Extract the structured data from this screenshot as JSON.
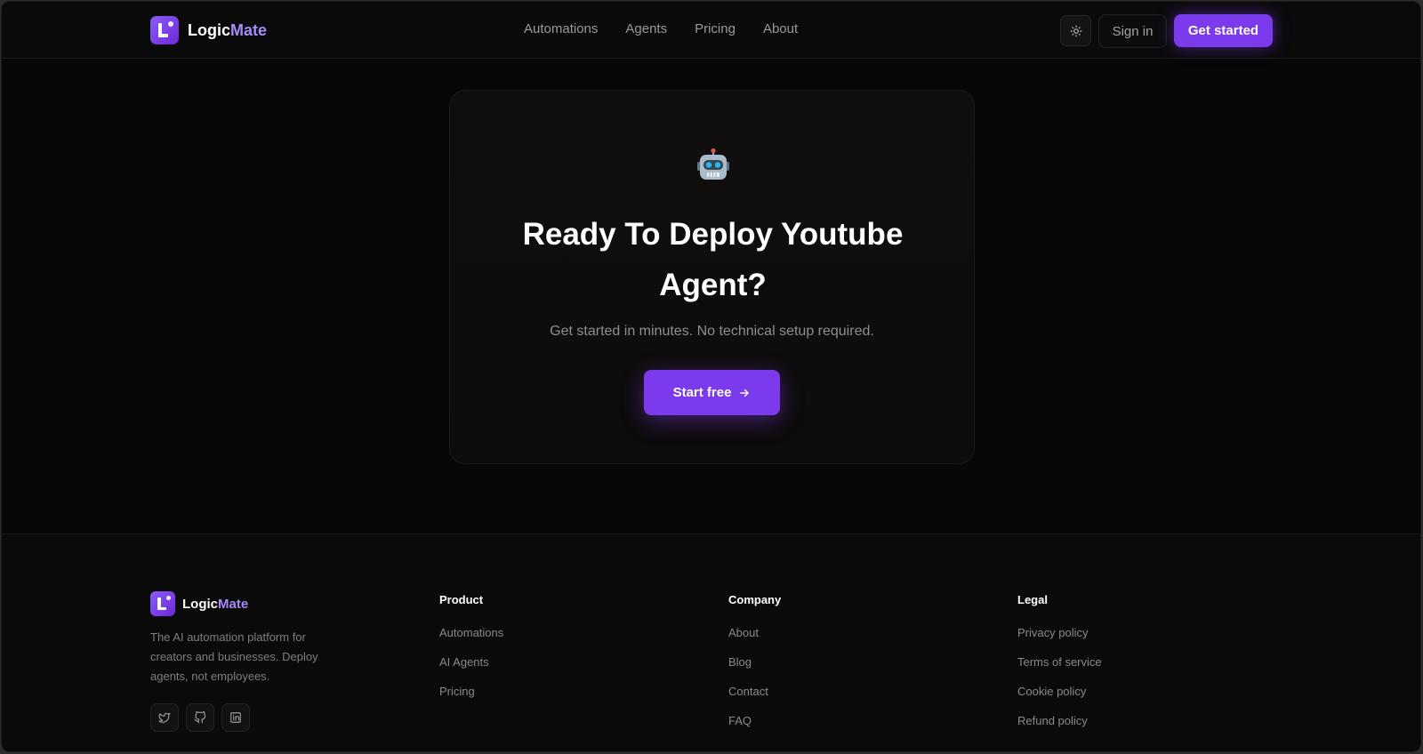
{
  "brand": {
    "name_main": "Logic",
    "name_accent": "Mate"
  },
  "nav": {
    "items": [
      {
        "label": "Automations"
      },
      {
        "label": "Agents"
      },
      {
        "label": "Pricing"
      },
      {
        "label": "About"
      }
    ],
    "signin_label": "Sign in",
    "getstarted_label": "Get started",
    "theme_icon": "sun-icon"
  },
  "cta": {
    "emoji": "robot-emoji",
    "title": "Ready To Deploy Youtube Agent?",
    "subtitle": "Get started in minutes. No technical setup required.",
    "button_label": "Start free"
  },
  "footer": {
    "description": "The AI automation platform for creators and businesses. Deploy agents, not employees.",
    "socials": [
      "twitter-icon",
      "github-icon",
      "linkedin-icon"
    ],
    "columns": [
      {
        "title": "Product",
        "links": [
          "Automations",
          "AI Agents",
          "Pricing"
        ]
      },
      {
        "title": "Company",
        "links": [
          "About",
          "Blog",
          "Contact",
          "FAQ"
        ]
      },
      {
        "title": "Legal",
        "links": [
          "Privacy policy",
          "Terms of service",
          "Cookie policy",
          "Refund policy"
        ]
      }
    ]
  },
  "colors": {
    "accent": "#7c3aed",
    "accent_light": "#a78bfa",
    "background": "#070707"
  }
}
